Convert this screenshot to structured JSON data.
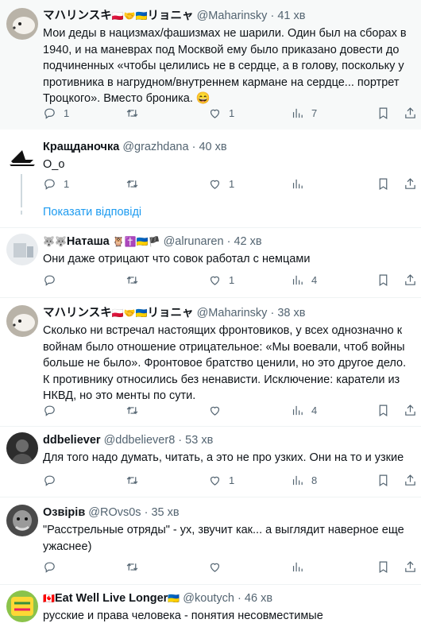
{
  "tweets": [
    {
      "name": "マハリンスキ",
      "flags": "🇵🇱🤝🇺🇦",
      "name2": "リョニャ",
      "handle": "@Maharinsky",
      "time": "41 хв",
      "text": "Мои деды в нацизмах/фашизмах не шарили. Один был на сборах в 1940, и на маневрах под Москвой ему было приказано довести до подчиненных «чтобы целились не в сердце, а в голову, поскольку у противника в нагрудном/внутреннем кармане на сердце... портрет Троцкого». Вместо броника. 😄",
      "replies": "1",
      "retweets": "",
      "likes": "1",
      "views": "7"
    },
    {
      "name": "Кращданочка",
      "flags": "",
      "name2": "",
      "handle": "@grazhdana",
      "time": "40 хв",
      "text": "О_о",
      "replies": "1",
      "retweets": "",
      "likes": "1",
      "views": ""
    },
    {
      "name": "Наташа",
      "prefix": "🐺🐺",
      "flags": "🦉✝️🇺🇦🏴",
      "name2": "",
      "handle": "@alrunaren",
      "time": "42 хв",
      "text": "Они даже отрицают что совок работал с немцами",
      "replies": "",
      "retweets": "",
      "likes": "1",
      "views": "4"
    },
    {
      "name": "マハリンスキ",
      "flags": "🇵🇱🤝🇺🇦",
      "name2": "リョニャ",
      "handle": "@Maharinsky",
      "time": "38 хв",
      "text": "Сколько ни встречал настоящих фронтовиков, у всех однозначно к войнам было отношение отрицательное: «Мы воевали, чтоб войны больше не было». Фронтовое братство ценили, но это другое дело. К противнику относились без ненависти. Исключение: каратели из НКВД, но это менты по сути.",
      "replies": "",
      "retweets": "",
      "likes": "",
      "views": "4"
    },
    {
      "name": "ddbeliever",
      "flags": "",
      "name2": "",
      "handle": "@ddbeliever8",
      "time": "53 хв",
      "text": "Для того надо думать, читать, а это не про узких. Они на то и узкие",
      "replies": "",
      "retweets": "",
      "likes": "1",
      "views": "8"
    },
    {
      "name": "Озвірів",
      "flags": "",
      "name2": "",
      "handle": "@ROvs0s",
      "time": "35 хв",
      "text": "\"Расстрельные отряды\" - ух, звучит как... а выглядит наверное еще ужаснее)",
      "replies": "",
      "retweets": "",
      "likes": "",
      "views": ""
    },
    {
      "name": "Eat Well Live Longer",
      "prefix": "🇨🇦",
      "flags": "🇺🇦",
      "name2": "",
      "handle": "@koutych",
      "time": "46 хв",
      "text": "русские и права человека - понятия несовместимые",
      "replies": "",
      "retweets": "",
      "likes": "",
      "views": ""
    }
  ],
  "show_replies": "Показати відповіді",
  "separator": "·"
}
